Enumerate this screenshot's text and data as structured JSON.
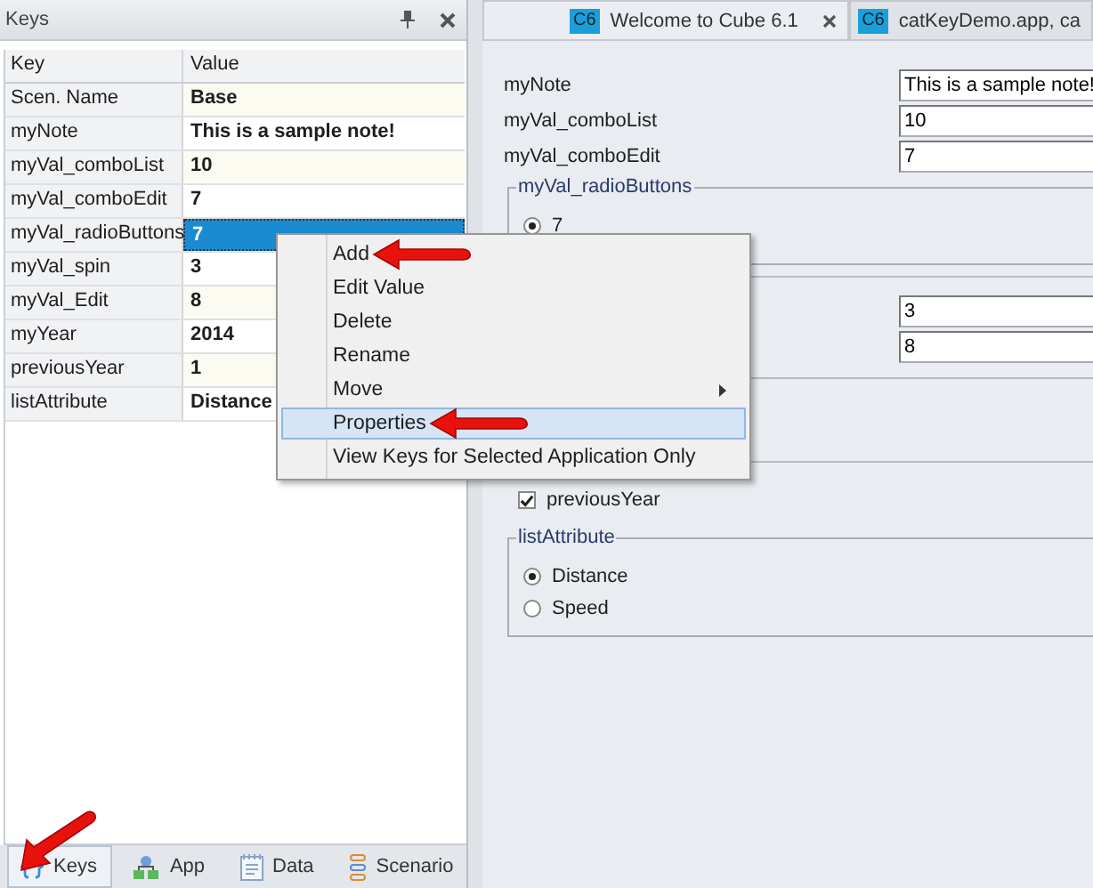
{
  "keys_panel": {
    "title": "Keys",
    "columns": [
      "Key",
      "Value"
    ],
    "rows": [
      {
        "key": "Scen. Name",
        "value": "Base",
        "selected": false
      },
      {
        "key": "myNote",
        "value": "This is a sample note!",
        "selected": false
      },
      {
        "key": "myVal_comboList",
        "value": "10",
        "selected": false
      },
      {
        "key": "myVal_comboEdit",
        "value": "7",
        "selected": false
      },
      {
        "key": "myVal_radioButtons",
        "value": "7",
        "selected": true
      },
      {
        "key": "myVal_spin",
        "value": "3",
        "selected": false
      },
      {
        "key": "myVal_Edit",
        "value": "8",
        "selected": false
      },
      {
        "key": "myYear",
        "value": "2014",
        "selected": false
      },
      {
        "key": "previousYear",
        "value": "1",
        "selected": false
      },
      {
        "key": "listAttribute",
        "value": "Distance",
        "selected": false
      }
    ]
  },
  "bottom_tabs": [
    {
      "label": "Keys",
      "kind": "braces",
      "selected": true
    },
    {
      "label": "App",
      "kind": "network",
      "selected": false
    },
    {
      "label": "Data",
      "kind": "document",
      "selected": false
    },
    {
      "label": "Scenario",
      "kind": "stack",
      "selected": false
    }
  ],
  "doc_tabs": [
    {
      "badge": "C6",
      "title": "Welcome to Cube 6.1",
      "selected": true,
      "closable": true
    },
    {
      "badge": "C6",
      "title": "catKeyDemo.app, ca",
      "selected": false,
      "closable": false
    }
  ],
  "form": {
    "fields": [
      {
        "label": "myNote",
        "value": "This is a sample note!"
      },
      {
        "label": "myVal_comboList",
        "value": "10"
      },
      {
        "label": "myVal_comboEdit",
        "value": "7"
      }
    ],
    "radio_group": {
      "title": "myVal_radioButtons",
      "options": [
        {
          "label": "7",
          "selected": true
        }
      ]
    },
    "fields2": [
      {
        "value": "3"
      },
      {
        "value": "8"
      }
    ],
    "checkbox": {
      "label": "previousYear",
      "checked": true
    },
    "list_group": {
      "title": "listAttribute",
      "options": [
        {
          "label": "Distance",
          "selected": true
        },
        {
          "label": "Speed",
          "selected": false
        }
      ]
    }
  },
  "context_menu": {
    "items": [
      {
        "label": "Add",
        "selected": false,
        "submenu": false
      },
      {
        "label": "Edit Value",
        "selected": false,
        "submenu": false
      },
      {
        "label": "Delete",
        "selected": false,
        "submenu": false
      },
      {
        "label": "Rename",
        "selected": false,
        "submenu": false
      },
      {
        "label": "Move",
        "selected": false,
        "submenu": true
      },
      {
        "label": "Properties",
        "selected": true,
        "submenu": false
      },
      {
        "label": "View Keys for Selected Application Only",
        "selected": false,
        "submenu": false
      }
    ]
  }
}
